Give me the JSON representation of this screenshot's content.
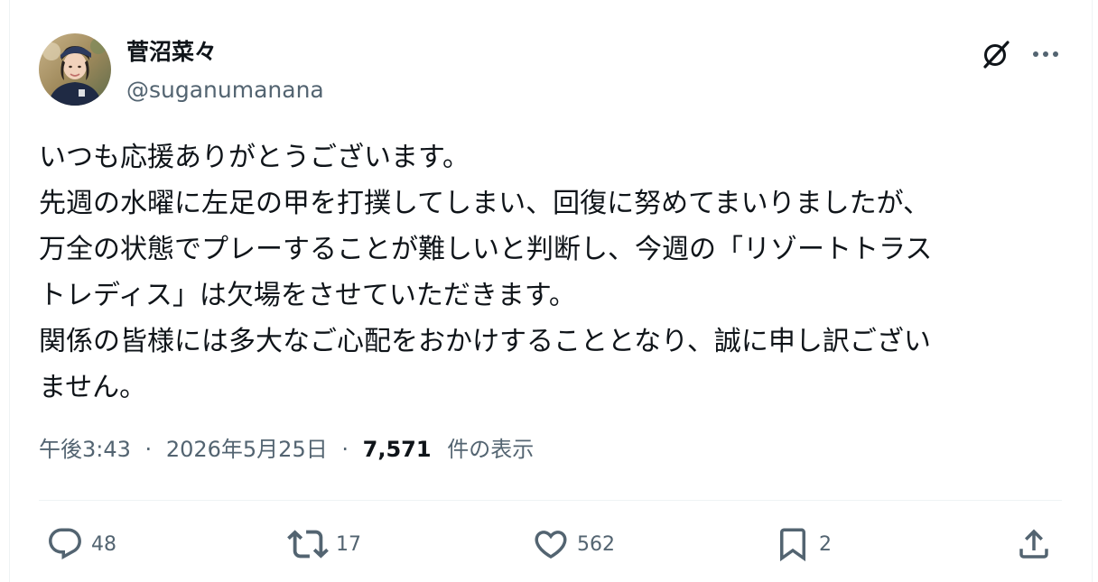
{
  "author": {
    "display_name": "菅沼菜々",
    "handle": "@suganumanana"
  },
  "tweet": {
    "lines": [
      "いつも応援ありがとうございます。",
      "先週の水曜に左足の甲を打撲してしまい、回復に努めてまいりましたが、",
      "万全の状態でプレーすることが難しいと判断し、今週の「リゾートトラス",
      "トレディス」は欠場をさせていただきます。",
      "関係の皆様には多大なご心配をおかけすることとなり、誠に申し訳ござい",
      "ません。"
    ]
  },
  "meta": {
    "time": "午後3:43",
    "separator": "·",
    "date": "2026年5月25日",
    "views_count": "7,571",
    "views_label": "件の表示"
  },
  "actions": {
    "reply_count": "48",
    "repost_count": "17",
    "like_count": "562",
    "bookmark_count": "2"
  },
  "icons": {
    "header": [
      "grok-icon",
      "more-icon"
    ],
    "actions": [
      "reply-icon",
      "repost-icon",
      "like-icon",
      "bookmark-icon",
      "share-icon"
    ]
  },
  "colors": {
    "text_primary": "#0f1419",
    "text_secondary": "#536471",
    "divider": "#eff3f4"
  }
}
